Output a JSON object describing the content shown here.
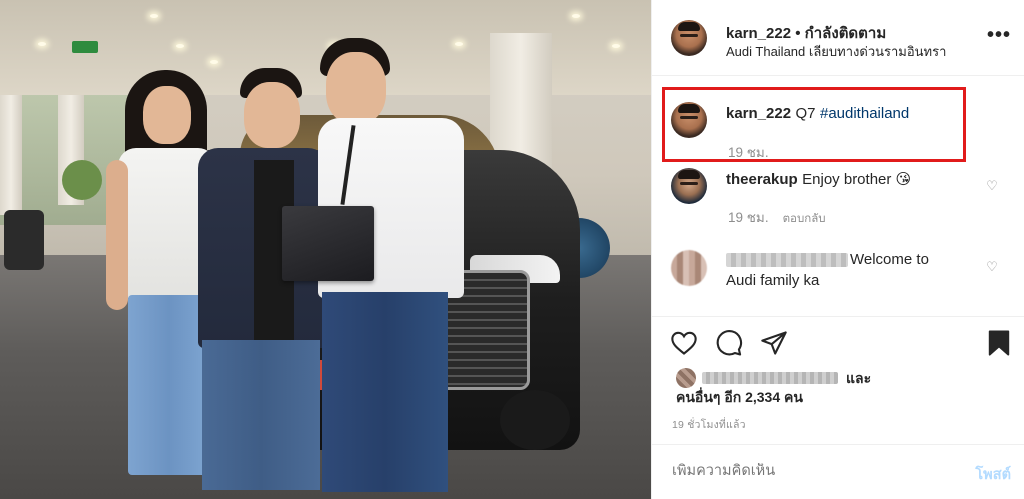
{
  "header": {
    "username": "karn_222",
    "separator": "•",
    "follow_status": "กำลังติดตาม",
    "location": "Audi Thailand เลียบทางด่วนรามอินทรา"
  },
  "caption": {
    "username": "karn_222",
    "text": "Q7",
    "hashtag": "#audithailand",
    "time": "19 ชม."
  },
  "comments": [
    {
      "username": "theerakup",
      "text": "Enjoy brother 😘",
      "time": "19 ชม.",
      "reply_label": "ตอบกลับ"
    },
    {
      "text_line1": "Welcome to",
      "text_line2": "Audi family ka"
    }
  ],
  "likes": {
    "and_label": "และ",
    "others_label": "คนอื่นๆ อีก 2,334 คน"
  },
  "post_time": "19 ชั่วโมงที่แล้ว",
  "add_comment": {
    "placeholder": "เพิ่มความคิดเห็น",
    "post_label": "โพสต์"
  },
  "icons": {
    "more": "more-options-icon",
    "like": "heart-icon",
    "comment": "comment-icon",
    "share": "share-icon",
    "save": "bookmark-icon"
  },
  "colors": {
    "highlight_border": "#e11b1b",
    "hashtag": "#00376b",
    "muted": "#8e8e8e",
    "post_button_disabled": "#b3dbff"
  }
}
